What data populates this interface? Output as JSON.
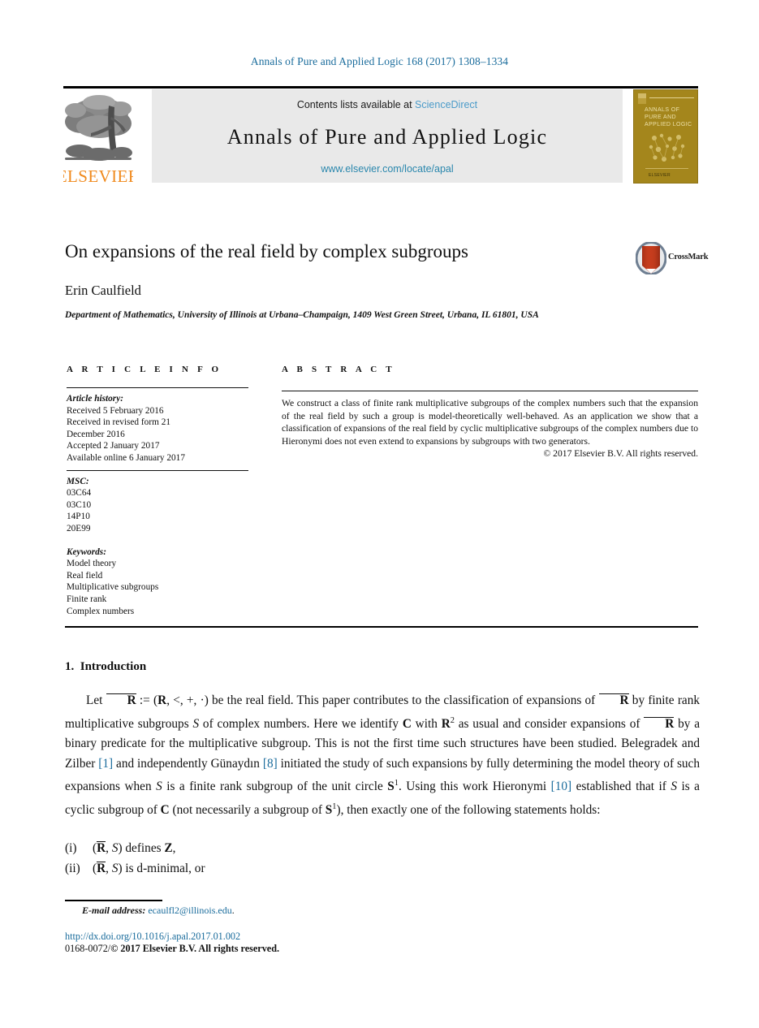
{
  "running_head": "Annals of Pure and Applied Logic 168 (2017) 1308–1334",
  "masthead": {
    "contents_prefix": "Contents lists available at ",
    "sciencedirect": "ScienceDirect",
    "journal_title": "Annals of Pure and Applied Logic",
    "journal_url": "www.elsevier.com/locate/apal",
    "publisher_logo_text": "ELSEVIER",
    "cover_title": "Annals of Pure and Applied Logic",
    "cover_footer": "ELSEVIER",
    "accent_link_color": "#4b9bc9",
    "accent_url_color": "#2a87ad",
    "cover_bg_color": "#a4861c",
    "panel_bg_color": "#e9e9e9"
  },
  "article": {
    "title": "On expansions of the real field by complex subgroups",
    "author": "Erin Caulfield",
    "affiliation": "Department of Mathematics, University of Illinois at Urbana–Champaign, 1409 West Green Street, Urbana, IL 61801, USA",
    "crossmark_label": "CrossMark"
  },
  "info": {
    "heading": "A R T I C L E    I N F O",
    "history_label": "Article history:",
    "history": [
      "Received 5 February 2016",
      "Received in revised form 21",
      "December 2016",
      "Accepted 2 January 2017",
      "Available online 6 January 2017"
    ],
    "msc_label": "MSC:",
    "msc": [
      "03C64",
      "03C10",
      "14P10",
      "20E99"
    ],
    "keywords_label": "Keywords:",
    "keywords": [
      "Model theory",
      "Real field",
      "Multiplicative subgroups",
      "Finite rank",
      "Complex numbers"
    ]
  },
  "abstract": {
    "heading": "A B S T R A C T",
    "body": "We construct a class of finite rank multiplicative subgroups of the complex numbers such that the expansion of the real field by such a group is model-theoretically well-behaved. As an application we show that a classification of expansions of the real field by cyclic multiplicative subgroups of the complex numbers due to Hieronymi does not even extend to expansions by subgroups with two generators.",
    "copyright": "© 2017 Elsevier B.V. All rights reserved."
  },
  "section": {
    "number": "1.",
    "heading": "Introduction"
  },
  "body": {
    "p1_parts": {
      "s1": "Let ",
      "m1": "R",
      "s2": " := (",
      "m2": "R",
      "s3": ", <, +, ·) be the real field. This paper contributes to the classification of expansions of ",
      "m3": "R",
      "s4": " by finite rank multiplicative subgroups ",
      "m4": "S",
      "s5": " of complex numbers. Here we identify ",
      "m5": "C",
      "s6": " with ",
      "m6": "R",
      "sup6": "2",
      "s7": " as usual and consider expansions of ",
      "m7": "R",
      "s8": " by a binary predicate for the multiplicative subgroup. This is not the first time such structures have been studied. Belegradek and Zilber ",
      "c1": "[1]",
      "s9": " and independently Günaydın ",
      "c2": "[8]",
      "s10": " initiated the study of such expansions by fully determining the model theory of such expansions when ",
      "m8": "S",
      "s11": " is a finite rank subgroup of the unit circle ",
      "m9": "S",
      "sup9": "1",
      "s12": ". Using this work Hieronymi ",
      "c3": "[10]",
      "s13": " established that if ",
      "m10": "S",
      "s14": " is a cyclic subgroup of ",
      "m11": "C",
      "s15": " (not necessarily a subgroup of ",
      "m12": "S",
      "sup12": "1",
      "s16": "), then exactly one of the following statements holds:"
    },
    "list": [
      {
        "marker": "(i)",
        "pre": "(",
        "m1": "R",
        "mid": ", ",
        "m2": "S",
        "post": ") defines ",
        "m3": "Z",
        "tail": ","
      },
      {
        "marker": "(ii)",
        "pre": "(",
        "m1": "R",
        "mid": ", ",
        "m2": "S",
        "post": ") is d-minimal, or",
        "m3": "",
        "tail": ""
      }
    ]
  },
  "footer": {
    "email_label": "E-mail address:",
    "email": "ecaulfl2@illinois.edu",
    "email_period": ".",
    "doi": "http://dx.doi.org/10.1016/j.apal.2017.01.002",
    "issn_prefix": "0168-0072/",
    "issn_rest": "© 2017 Elsevier B.V. All rights reserved.",
    "link_color": "#1a6c9c"
  }
}
